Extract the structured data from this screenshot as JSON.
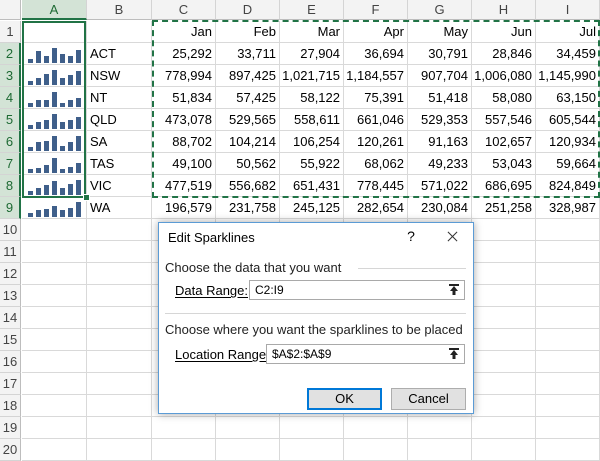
{
  "columns": [
    "A",
    "B",
    "C",
    "D",
    "E",
    "F",
    "G",
    "H",
    "I"
  ],
  "rows": [
    "1",
    "2",
    "3",
    "4",
    "5",
    "6",
    "7",
    "8",
    "9",
    "10",
    "11",
    "12",
    "13",
    "14",
    "15",
    "16",
    "17",
    "18",
    "19",
    "20"
  ],
  "months": [
    "Jan",
    "Feb",
    "Mar",
    "Apr",
    "May",
    "Jun",
    "Jul"
  ],
  "regions": [
    {
      "name": "ACT",
      "values": [
        "25,292",
        "33,711",
        "27,904",
        "36,694",
        "30,791",
        "28,846",
        "34,459"
      ],
      "spark": [
        25292,
        33711,
        27904,
        36694,
        30791,
        28846,
        34459
      ]
    },
    {
      "name": "NSW",
      "values": [
        "778,994",
        "897,425",
        "1,021,715",
        "1,184,557",
        "907,704",
        "1,006,080",
        "1,145,990"
      ],
      "spark": [
        778994,
        897425,
        1021715,
        1184557,
        907704,
        1006080,
        1145990
      ]
    },
    {
      "name": "NT",
      "values": [
        "51,834",
        "57,425",
        "58,122",
        "75,391",
        "51,418",
        "58,080",
        "63,150"
      ],
      "spark": [
        51834,
        57425,
        58122,
        75391,
        51418,
        58080,
        63150
      ]
    },
    {
      "name": "QLD",
      "values": [
        "473,078",
        "529,565",
        "558,611",
        "661,046",
        "529,353",
        "557,546",
        "605,544"
      ],
      "spark": [
        473078,
        529565,
        558611,
        661046,
        529353,
        557546,
        605544
      ]
    },
    {
      "name": "SA",
      "values": [
        "88,702",
        "104,214",
        "106,254",
        "120,261",
        "91,163",
        "102,657",
        "120,934"
      ],
      "spark": [
        88702,
        104214,
        106254,
        120261,
        91163,
        102657,
        120934
      ]
    },
    {
      "name": "TAS",
      "values": [
        "49,100",
        "50,562",
        "55,922",
        "68,062",
        "49,233",
        "53,043",
        "59,664"
      ],
      "spark": [
        49100,
        50562,
        55922,
        68062,
        49233,
        53043,
        59664
      ]
    },
    {
      "name": "VIC",
      "values": [
        "477,519",
        "556,682",
        "651,431",
        "778,445",
        "571,022",
        "686,695",
        "824,849"
      ],
      "spark": [
        477519,
        556682,
        651431,
        778445,
        571022,
        686695,
        824849
      ]
    },
    {
      "name": "WA",
      "values": [
        "196,579",
        "231,758",
        "245,125",
        "282,654",
        "230,084",
        "251,258",
        "328,987"
      ],
      "spark": [
        196579,
        231758,
        245125,
        282654,
        230084,
        251258,
        328987
      ]
    }
  ],
  "dialog": {
    "title": "Edit Sparklines",
    "help": "?",
    "section_data": "Choose the data that you want",
    "data_range_label": "Data Range:",
    "data_range_value": "C2:I9",
    "section_location": "Choose where you want the sparklines to be placed",
    "location_range_label": "Location Range:",
    "location_range_value": "$A$2:$A$9",
    "ok_label": "OK",
    "cancel_label": "Cancel"
  },
  "colors": {
    "accent": "#217346",
    "sparkline": "#3f5f8a",
    "dialog_border": "#5b9bd5",
    "ok_border": "#0078d7"
  }
}
